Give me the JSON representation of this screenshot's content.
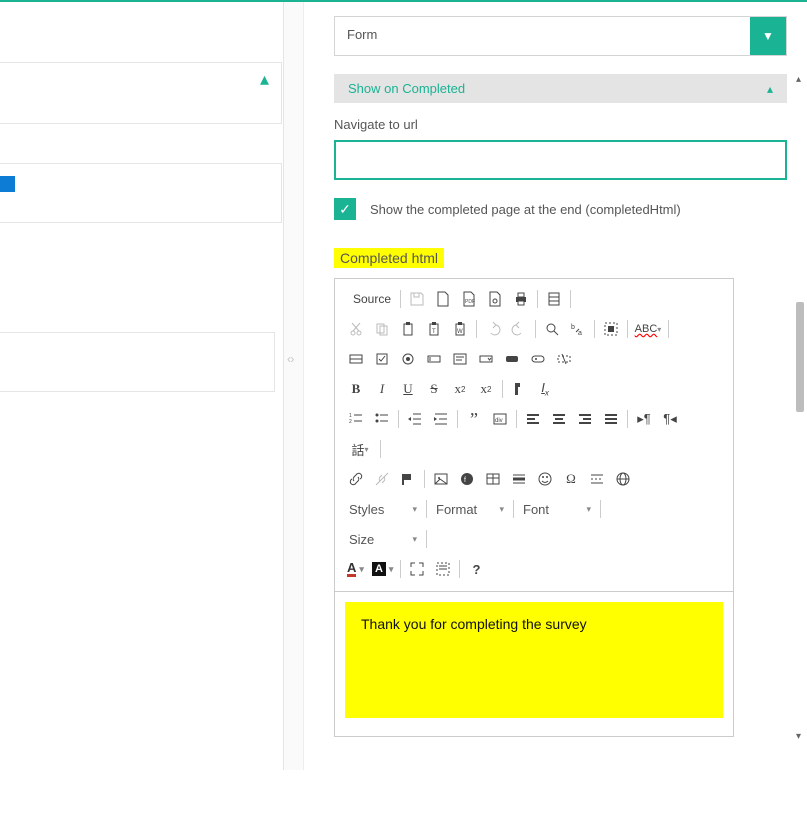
{
  "header_select": {
    "label": "Form"
  },
  "section": {
    "title": "Show on Completed"
  },
  "navigate": {
    "label": "Navigate to url",
    "value": ""
  },
  "show_completed": {
    "label": "Show the completed page at the end (completedHtml)",
    "checked": true
  },
  "completed_html": {
    "label": "Completed html",
    "content": "Thank you for completing the survey"
  },
  "toolbar": {
    "source": "Source",
    "styles": "Styles",
    "format": "Format",
    "font": "Font",
    "size": "Size",
    "lang": "話"
  }
}
